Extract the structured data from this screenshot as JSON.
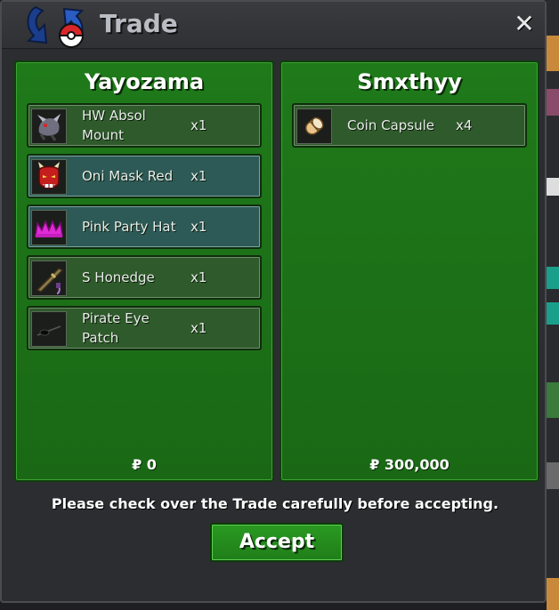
{
  "window": {
    "title": "Trade",
    "close_label": "✕"
  },
  "left": {
    "player": "Yayozama",
    "money": "₽ 0",
    "items": [
      {
        "name": "HW Absol Mount",
        "qty": "x1",
        "icon": "absol-mount-icon",
        "selected": false
      },
      {
        "name": "Oni Mask Red",
        "qty": "x1",
        "icon": "oni-mask-icon",
        "selected": true
      },
      {
        "name": "Pink Party Hat",
        "qty": "x1",
        "icon": "party-hat-icon",
        "selected": true
      },
      {
        "name": "S Honedge",
        "qty": "x1",
        "icon": "honedge-icon",
        "selected": false
      },
      {
        "name": "Pirate Eye Patch",
        "qty": "x1",
        "icon": "eye-patch-icon",
        "selected": false
      }
    ]
  },
  "right": {
    "player": "Smxthyy",
    "money": "₽ 300,000",
    "items": [
      {
        "name": "Coin Capsule",
        "qty": "x4",
        "icon": "coin-capsule-icon",
        "selected": false
      }
    ]
  },
  "notice": "Please check over the Trade carefully before accepting.",
  "accept_label": "Accept",
  "colors": {
    "panel": "#1f7a1a",
    "item": "#2f5a2b",
    "item_selected": "#2d5a56",
    "accept": "#2a9a22"
  }
}
